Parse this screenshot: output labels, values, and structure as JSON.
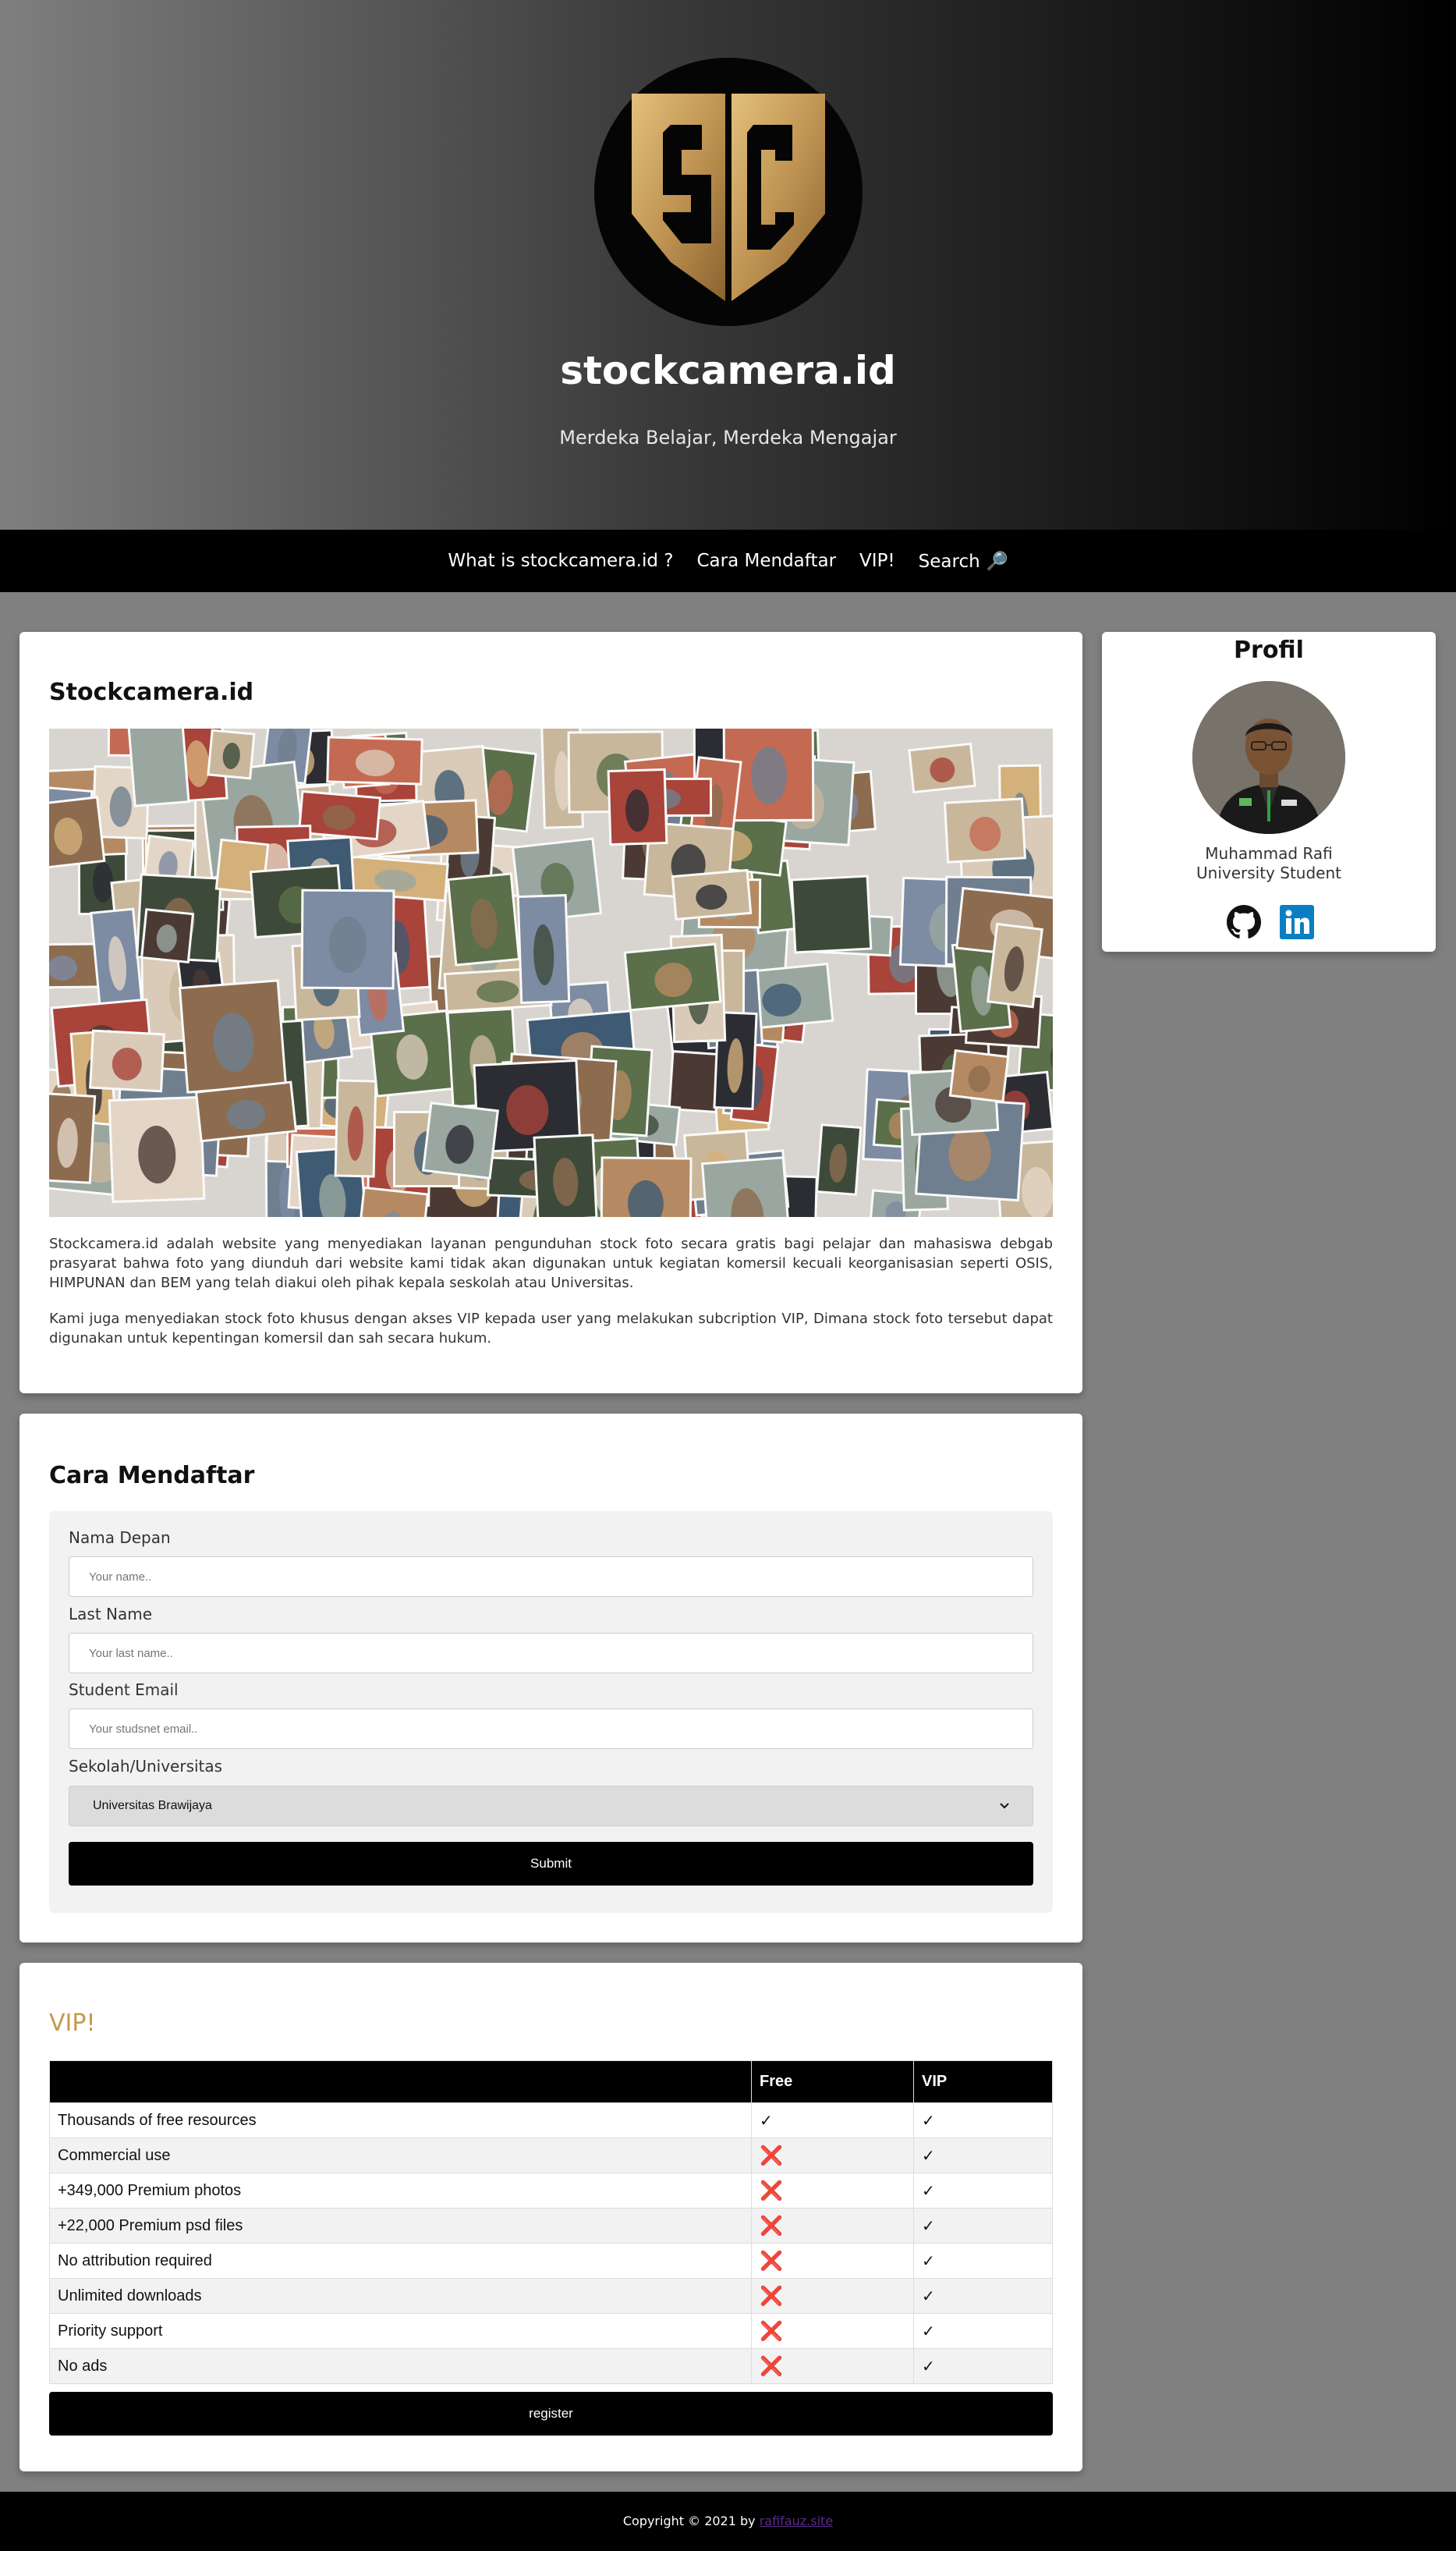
{
  "header": {
    "title": "stockcamera.id",
    "tagline": "Merdeka Belajar, Merdeka Mengajar",
    "logo_letters": "SC",
    "logo_color": "#c8a062"
  },
  "nav": {
    "items": [
      "What is stockcamera.id ?",
      "Cara Mendaftar",
      "VIP!",
      "Search 🔎"
    ]
  },
  "about": {
    "title": "Stockcamera.id",
    "paragraph1": "Stockcamera.id adalah website yang menyediakan layanan pengunduhan stock foto secara gratis bagi pelajar dan mahasiswa debgab prasyarat bahwa foto yang diunduh dari website kami tidak akan digunakan untuk kegiatan komersil kecuali keorganisasian seperti OSIS, HIMPUNAN dan BEM yang telah diakui oleh pihak kepala seskolah atau Universitas.",
    "paragraph2": "Kami juga menyediakan stock foto khusus dengan akses VIP kepada user yang melakukan subcription VIP, Dimana stock foto tersebut dapat digunakan untuk kepentingan komersil dan sah secara hukum."
  },
  "register": {
    "title": "Cara Mendaftar",
    "first_name_label": "Nama Depan",
    "first_name_placeholder": "Your name..",
    "last_name_label": "Last Name",
    "last_name_placeholder": "Your last name..",
    "email_label": "Student Email",
    "email_placeholder": "Your studsnet email..",
    "school_label": "Sekolah/Universitas",
    "school_selected": "Universitas Brawijaya",
    "submit_label": "Submit"
  },
  "vip": {
    "title": "VIP!",
    "columns": [
      "",
      "Free",
      "VIP"
    ],
    "rows": [
      {
        "feature": "Thousands of free resources",
        "free": "✓",
        "vip": "✓"
      },
      {
        "feature": "Commercial use",
        "free": "❌",
        "vip": "✓"
      },
      {
        "feature": "+349,000 Premium photos",
        "free": "❌",
        "vip": "✓"
      },
      {
        "feature": "+22,000 Premium psd files",
        "free": "❌",
        "vip": "✓"
      },
      {
        "feature": "No attribution required",
        "free": "❌",
        "vip": "✓"
      },
      {
        "feature": "Unlimited downloads",
        "free": "❌",
        "vip": "✓"
      },
      {
        "feature": "Priority support",
        "free": "❌",
        "vip": "✓"
      },
      {
        "feature": "No ads",
        "free": "❌",
        "vip": "✓"
      }
    ],
    "register_label": "register"
  },
  "profile": {
    "title": "Profil",
    "name": "Muhammad Rafi",
    "role": "University Student",
    "icons": [
      "github-icon",
      "linkedin-icon"
    ]
  },
  "footer": {
    "text": "Copyright © 2021 by ",
    "link": "rafifauz.site"
  }
}
